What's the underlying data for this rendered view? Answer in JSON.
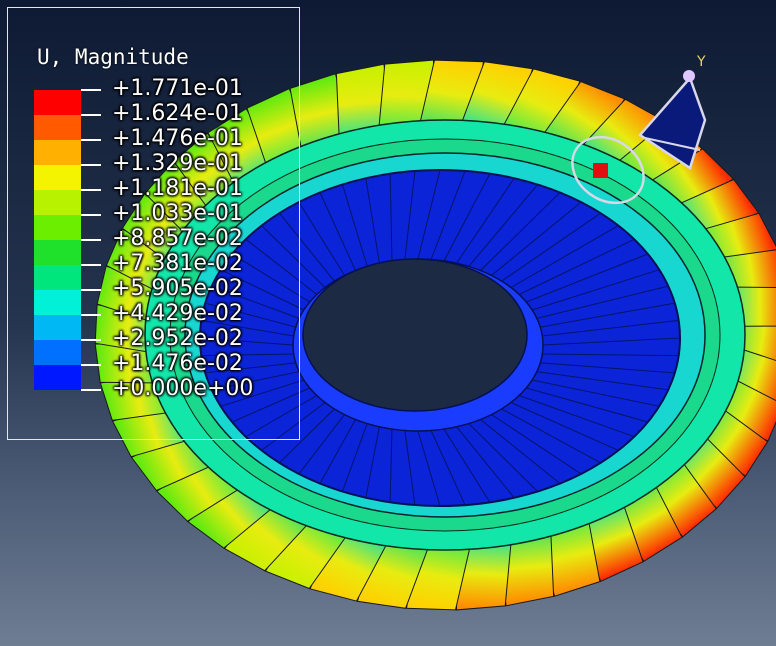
{
  "legend": {
    "title": "U, Magnitude",
    "colors": [
      "#ff0000",
      "#ff5a00",
      "#ffb000",
      "#f4f400",
      "#b8f200",
      "#6cee00",
      "#1fe02a",
      "#00e67c",
      "#00f0d8",
      "#00b8f4",
      "#0070ff",
      "#0018ff"
    ],
    "labels": [
      "+1.771e-01",
      "+1.624e-01",
      "+1.476e-01",
      "+1.329e-01",
      "+1.181e-01",
      "+1.033e-01",
      "+8.857e-02",
      "+7.381e-02",
      "+5.905e-02",
      "+4.429e-02",
      "+2.952e-02",
      "+1.476e-02",
      "+0.000e+00"
    ]
  },
  "triad": {
    "y_label": "Y"
  },
  "colors": {
    "hub": "#0b1fd8",
    "hub_inner": "#2a40ff",
    "ring": "#00d8c8",
    "blade_root": "#00e0b0"
  }
}
